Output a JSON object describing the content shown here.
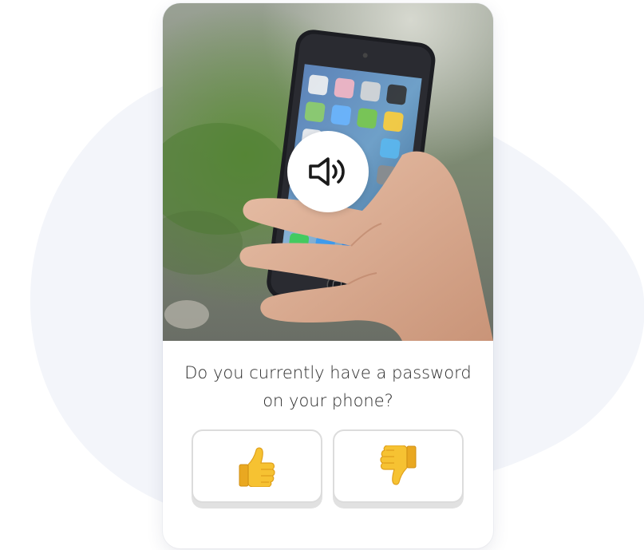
{
  "question": {
    "line1": "Do you currently have a password",
    "line2": "on your phone?"
  },
  "audio_button": {
    "icon": "speaker-icon"
  },
  "answers": [
    {
      "icon": "thumbs-up-icon"
    },
    {
      "icon": "thumbs-down-icon"
    }
  ],
  "colors": {
    "blob": "#f3f5fa",
    "card_background": "#ffffff",
    "button_border": "#dcdcdc",
    "thumb_yellow": "#f6c232",
    "thumb_shadow": "#e0a01c",
    "text": "#2b2b2b"
  }
}
